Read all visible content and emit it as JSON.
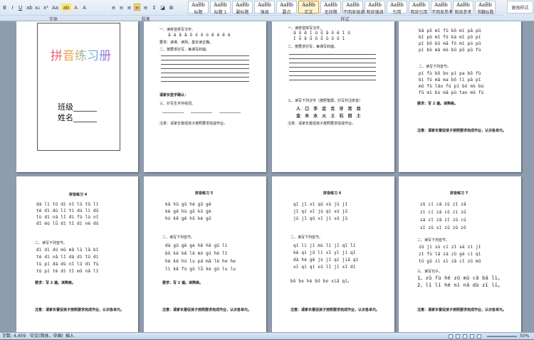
{
  "ribbon": {
    "group_labels": {
      "font": "字体",
      "paragraph": "段落",
      "styles": "样式"
    },
    "styles": [
      {
        "label": "标题",
        "selected": false
      },
      {
        "label": "标题 1",
        "selected": false
      },
      {
        "label": "副标题",
        "selected": false
      },
      {
        "label": "强调",
        "selected": false
      },
      {
        "label": "要点",
        "selected": false
      },
      {
        "label": "正文",
        "selected": true
      },
      {
        "label": "无间隔",
        "selected": false
      },
      {
        "label": "不明显强调",
        "selected": false
      },
      {
        "label": "明显强调",
        "selected": false
      },
      {
        "label": "引用",
        "selected": false
      },
      {
        "label": "明显引用",
        "selected": false
      },
      {
        "label": "不明显参考",
        "selected": false
      },
      {
        "label": "明显参考",
        "selected": false
      },
      {
        "label": "书籍标题",
        "selected": false
      }
    ],
    "change_styles": "更改样式"
  },
  "pages": {
    "cover": {
      "title": "拼音练习册",
      "class_label": "班级______",
      "name_label": "姓名______"
    },
    "p2": {
      "l1": "一、读拼音拼写汉字。",
      "l2": "ā á ǎ à ō ó ǒ ò ē é ě è",
      "l3": "要求：读准、读熟，基本读正确。",
      "l4": "二、按要求抄写，每课写四遍。",
      "l5": "请家长签字确认：",
      "l6": "三、抄写生字并组词。",
      "l7": "注意：请家长督促孩子按照要求完成作业。"
    },
    "p3": {
      "l1": "一、读拼音拼写汉字。",
      "l2": "ā ō ē ī ū ǖ ǎ ǒ ě ǐ ǔ",
      "l3": "ǐ ǖ ě ǖ ō ǚ ǔ ǒ ǔ ǐ",
      "l4": "二、按要求抄写，每课写四遍。",
      "l5": "三、读写下列汉字（按照笔顺，抄写并注拼音）",
      "l6": "人 口 手 足 舌 牙 耳 目",
      "l7": "金 木 水 火 土 石 田 土",
      "l8": "注意：请家长督促孩子按照要求完成作业。"
    },
    "p4": {
      "rows": [
        "bā pō mī fū bō mí pā pū",
        "bǐ pò mǐ fó bà mǐ pǔ pí",
        "pī bō bǔ mā fó mì pú pū",
        "pí bò mà mò bū pǔ pū fù"
      ],
      "l1": "二、读写下列音节。",
      "rows2": [
        "pí fù   bō bo   pí pa   bō fù",
        "bì fú   mā ma   bō lí   pā pī",
        "mǔ fù   lǎo fú   pī bó   mò bù",
        "fǔ mì   bù mǎ   pú tao   mǔ fù"
      ],
      "l2": "要求：写 2 遍。读熟练。",
      "l3": "注意：请家长督促孩子按照要求完成作业，认识各单元。"
    },
    "p5": {
      "title": "拼音练习 4",
      "rows": [
        "dà lì   tǔ dì   nǐ  lū  tǔ  lì",
        "tè dì   dú lì   tí  dú  lì  dǔ",
        "lù dì   nà lǐ   dì  fù  lù  nǐ",
        "dī mù   lǜ dì   tǐ  dì  nè  dǔ"
      ],
      "l1": "二、读写下列音节。",
      "rows2": [
        "dì dì   dú mù   mǎ lù   lā bǐ",
        "tè dì   nǎ lǐ   dà dì   tǔ dì",
        "lù pí   dà dù   nǐ lǔ   dì fù",
        "tǔ pí   tè dì   tǐ mǔ   nǎ lǐ"
      ],
      "l2": "要求：写 2 遍。读熟练。",
      "l3": "注意：请家长督促孩子按照要求完成作业，认识各单元。"
    },
    "p6": {
      "title": "拼音练习 5",
      "rows": [
        "kā  hū  gǔ  hé  gū  gē",
        "kè  gē  hù  gǔ  kǔ  gè",
        "hú  kě  gē  hǔ  kè  gū"
      ],
      "l1": "二、读写下列音节。",
      "rows2": [
        "dà gū   gē ge   hē hē   gǔ lì",
        "bǔ kè   kě lè   mó gū   hé lǐ",
        "hè kè   hú lu   pá mǎ   lè he he",
        "lì kě   fù gū   lǚ kè   gū lu lu"
      ],
      "l2": "要求：写 2 遍。读熟练。",
      "l3": "注意：请家长督促孩子按照要求完成作业，认识各单元。"
    },
    "p7": {
      "title": "拼音练习 6",
      "rows": [
        "qī  jǐ  xǐ  qǔ  xù  jū  jǐ",
        "jī  qí  xī  jù  qì  xù  jū",
        "jū  jǐ  qǔ  xī  jì  xǔ  jū"
      ],
      "l1": "二、读写下列音节。",
      "rows2": [
        "qí lì   jī mù   lì jī   qǐ lì",
        "kè qì   jǔ lì   xǐ yī   jí qī",
        "dà hé   gē jù   jī qí   jiā qí",
        "xī qí   qí xǔ   lǐ jī   xǐ dì"
      ],
      "l2": "bō bo hé bō bo xiǎ qí。",
      "l3": "注意：请家长督促孩子按照要求完成作业，认识各单元。"
    },
    "p8": {
      "title": "拼音练习 7",
      "rows": [
        "zǔ cí  cǎ  zū  zǐ  zā",
        "zì  cí  zá  cǔ  zì  zǔ",
        "sā  zǐ  zǎ  zī  zǔ  cū",
        "sī  zǔ  sǐ  zū  zǔ  zǒ"
      ],
      "l1": "二、读写下列音节。",
      "rows2": [
        "zǔ jì   sù cí   zǐ sè   zì jǐ",
        "zǐ fù   lā zá   zǔ gè   cí qì",
        "tū gǔ   zì sì   zā cǐ   zū mǔ"
      ],
      "l2": "三、读写句子。",
      "s1": "1、zǔ fù hé zǔ mǔ cǎ bǎ lì。",
      "s2": "2、lǐ lǐ hé nǐ nǎ dù zǐ lǐ。",
      "l3": "注意：请家长督促孩子按照要求完成作业，认识各单元。"
    }
  },
  "statusbar": {
    "words": "字数: 4,459",
    "lang": "中文(简体，中国)",
    "mode": "插入",
    "zoom": "50%"
  }
}
